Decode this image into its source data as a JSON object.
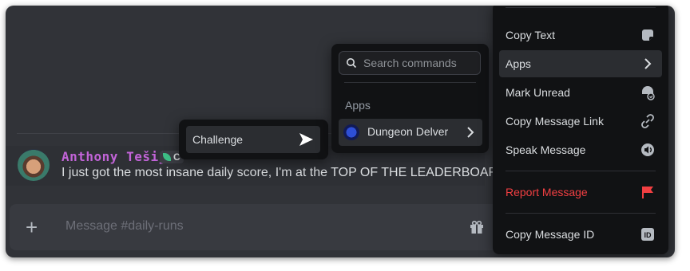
{
  "message": {
    "username": "Anthony Tešija",
    "tag_text": "C",
    "text": "I just got the most insane daily score, I'm at the TOP OF THE LEADERBOARD!!!"
  },
  "composer": {
    "placeholder": "Message #daily-runs"
  },
  "context_menu": {
    "items": [
      {
        "label": "Copy Text",
        "icon": "copy-text-icon"
      },
      {
        "label": "Apps",
        "icon": "chevron-right-icon",
        "active": true
      },
      {
        "label": "Mark Unread",
        "icon": "mark-unread-icon"
      },
      {
        "label": "Copy Message Link",
        "icon": "link-icon"
      },
      {
        "label": "Speak Message",
        "icon": "speaker-icon"
      },
      {
        "label": "Report Message",
        "icon": "flag-icon",
        "danger": true
      },
      {
        "label": "Copy Message ID",
        "icon": "id-icon"
      }
    ]
  },
  "apps_submenu": {
    "search_placeholder": "Search commands",
    "heading": "Apps",
    "app_label": "Dungeon Delver"
  },
  "challenge_submenu": {
    "label": "Challenge"
  },
  "colors": {
    "username": "#c264d8",
    "danger": "#f23f42",
    "background": "#313338",
    "menu": "#111214"
  }
}
